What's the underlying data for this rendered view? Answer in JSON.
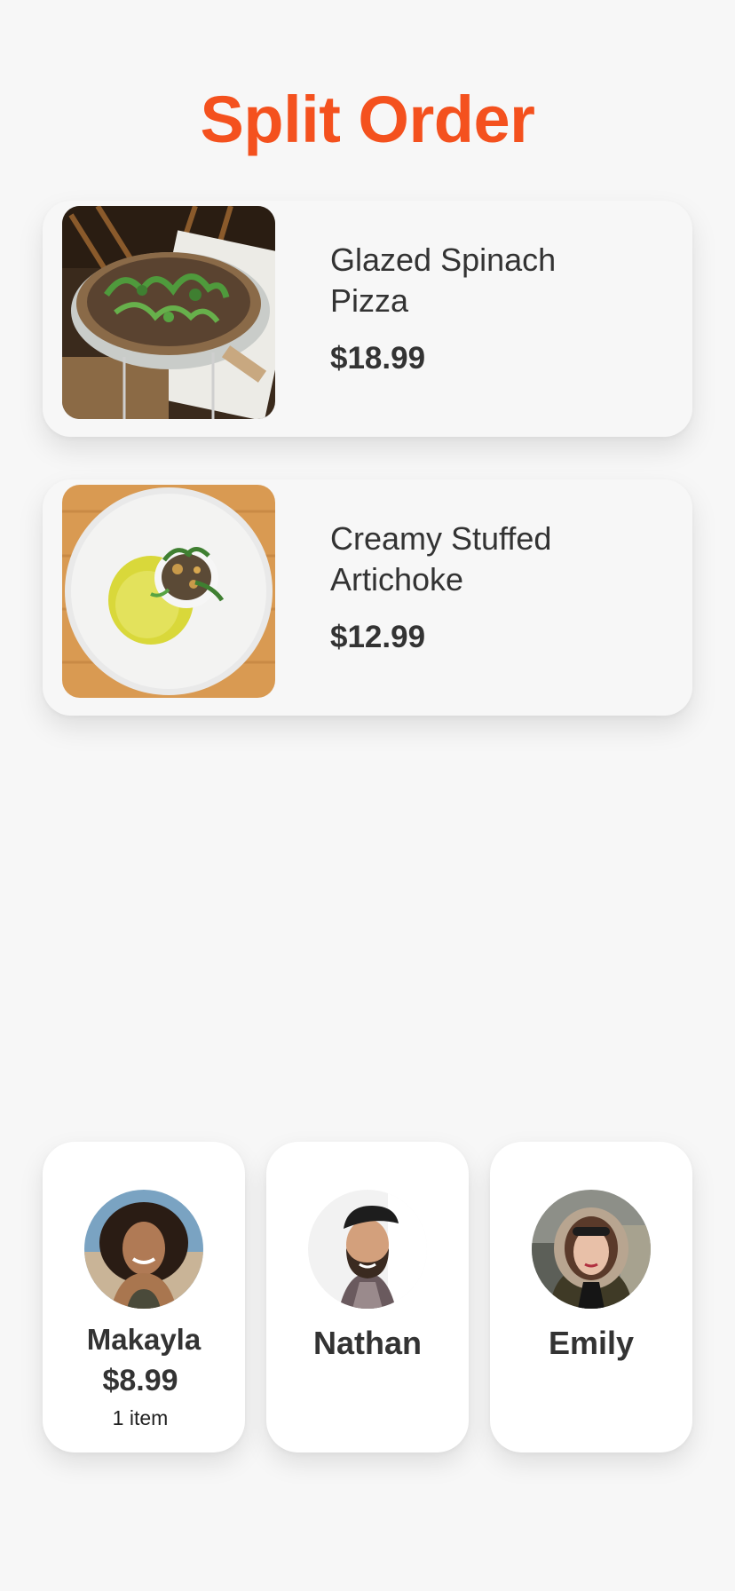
{
  "header": {
    "title": "Split Order"
  },
  "order_items": [
    {
      "name": "Glazed Spinach Pizza",
      "price": "$18.99",
      "image": "pizza-photo"
    },
    {
      "name": "Creamy Stuffed Artichoke",
      "price": "$12.99",
      "image": "artichoke-plate-photo"
    }
  ],
  "people": [
    {
      "name": "Makayla",
      "amount": "$8.99",
      "items": "1 item",
      "avatar": "makayla-avatar-photo"
    },
    {
      "name": "Nathan",
      "avatar": "nathan-avatar-photo"
    },
    {
      "name": "Emily",
      "avatar": "emily-avatar-photo"
    }
  ],
  "colors": {
    "accent": "#f4511e",
    "background": "#f7f7f7",
    "card": "#ffffff",
    "text": "#333333"
  }
}
